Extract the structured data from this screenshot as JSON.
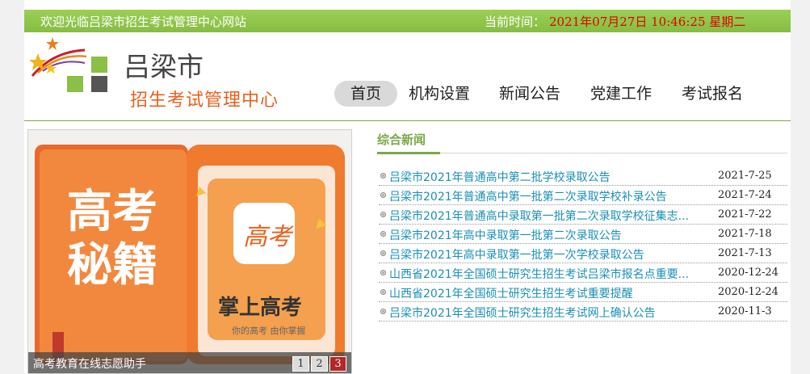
{
  "topbar": {
    "welcome": "欢迎光临吕梁市招生考试管理中心网站",
    "time_label": "当前时间：",
    "time_value": "2021年07月27日 10:46:25 星期二"
  },
  "brand": {
    "name_line1": "吕梁市",
    "name_line2": "招生考试管理中心"
  },
  "nav": {
    "items": [
      {
        "label": "首页",
        "active": true
      },
      {
        "label": "机构设置",
        "active": false
      },
      {
        "label": "新闻公告",
        "active": false
      },
      {
        "label": "党建工作",
        "active": false
      },
      {
        "label": "考试报名",
        "active": false
      }
    ]
  },
  "banner": {
    "book_title_1": "高考",
    "book_title_2": "秘籍",
    "phone_icon_text": "高考",
    "phone_title": "掌上高考",
    "phone_subtitle": "你的高考 由你掌握",
    "caption": "高考教育在线志愿助手",
    "pages": [
      "1",
      "2",
      "3"
    ],
    "active_page": "3"
  },
  "news": {
    "title": "综合新闻",
    "items": [
      {
        "title": "吕梁市2021年普通高中第二批学校录取公告",
        "date": "2021-7-25"
      },
      {
        "title": "吕梁市2021年普通高中第一批第二次录取学校补录公告",
        "date": "2021-7-24"
      },
      {
        "title": "吕梁市2021年普通高中录取第一批第二次录取学校征集志...",
        "date": "2021-7-22"
      },
      {
        "title": "吕梁市2021年高中录取第一批第二次录取公告",
        "date": "2021-7-18"
      },
      {
        "title": "吕梁市2021年高中录取第一批第一次学校录取公告",
        "date": "2021-7-13"
      },
      {
        "title": "山西省2021年全国硕士研究生招生考试吕梁市报名点重要...",
        "date": "2020-12-24"
      },
      {
        "title": "山西省2021年全国硕士研究生招生考试重要提醒",
        "date": "2020-12-24"
      },
      {
        "title": "吕梁市2021年全国硕士研究生招生考试网上确认公告",
        "date": "2020-11-3"
      }
    ]
  },
  "colors": {
    "accent_green": "#8bc34a",
    "link_blue": "#1a8fb5",
    "brand_orange": "#e8601c",
    "time_red": "#e00000"
  }
}
